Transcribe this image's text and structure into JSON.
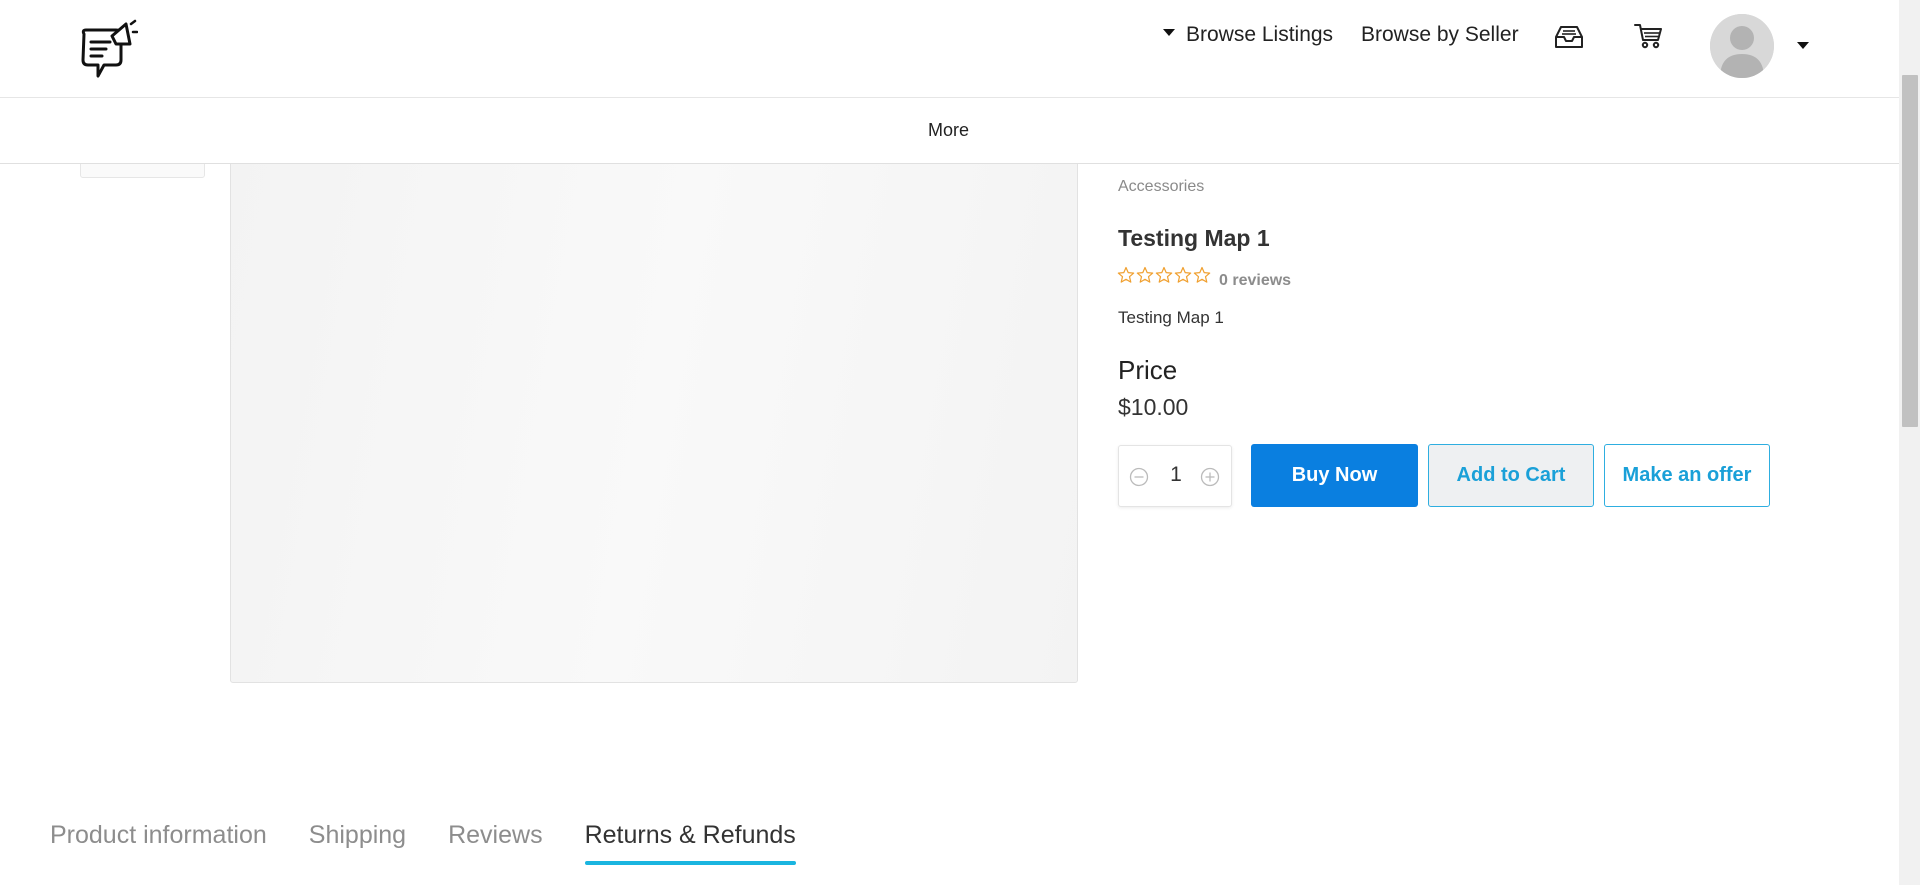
{
  "header": {
    "nav": {
      "browse_listings": "Browse Listings",
      "browse_by_seller": "Browse by Seller"
    },
    "icons": {
      "logo": "chat-megaphone-logo",
      "inbox": "inbox-icon",
      "cart": "cart-icon",
      "avatar": "user-avatar"
    }
  },
  "subnav": {
    "more": "More"
  },
  "product": {
    "category": "Accessories",
    "title": "Testing Map 1",
    "rating": 0,
    "rating_max": 5,
    "reviews_count": "0 reviews",
    "description": "Testing Map 1",
    "price_label": "Price",
    "price_value": "$10.00",
    "quantity": "1"
  },
  "actions": {
    "buy_now": "Buy Now",
    "add_to_cart": "Add to Cart",
    "make_offer": "Make an offer"
  },
  "tabs": [
    {
      "label": "Product information",
      "active": false
    },
    {
      "label": "Shipping",
      "active": false
    },
    {
      "label": "Reviews",
      "active": false
    },
    {
      "label": "Returns & Refunds",
      "active": true
    }
  ],
  "colors": {
    "primary_button": "#0a7fe0",
    "accent": "#1aa0d8",
    "tab_underline": "#1ab5e0",
    "star": "#f0a030"
  }
}
